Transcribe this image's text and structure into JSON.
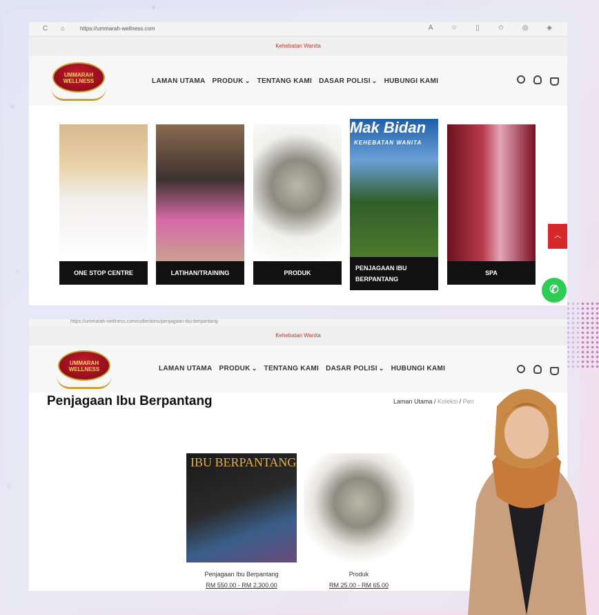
{
  "screenshot_top": {
    "url": "https://ummarah-wellness.com",
    "announcement": "Kehebatan Wanita",
    "logo_text": "UMMARAH WELLNESS",
    "nav": [
      {
        "label": "LAMAN UTAMA",
        "dropdown": false
      },
      {
        "label": "PRODUK",
        "dropdown": true
      },
      {
        "label": "TENTANG KAMI",
        "dropdown": false
      },
      {
        "label": "DASAR POLISI",
        "dropdown": true
      },
      {
        "label": "HUBUNGI KAMI",
        "dropdown": false
      }
    ],
    "tiles": [
      {
        "label": "ONE STOP CENTRE"
      },
      {
        "label": "LATIHAN/TRAINING"
      },
      {
        "label": "PRODUK"
      },
      {
        "label": "PENJAGAAN IBU BERPANTANG",
        "banner": "Mak Bidan",
        "banner_sub": "KEHEBATAN WANITA"
      },
      {
        "label": "SPA"
      }
    ]
  },
  "screenshot_bottom": {
    "url": "https://ummarah-wellness.com/collections/penjagaan-ibu-berpantang",
    "announcement": "Kehebatan Wanita",
    "logo_text": "UMMARAH WELLNESS",
    "nav": [
      {
        "label": "LAMAN UTAMA"
      },
      {
        "label": "PRODUK"
      },
      {
        "label": "TENTANG KAMI"
      },
      {
        "label": "DASAR POLISI"
      },
      {
        "label": "HUBUNGI KAMI"
      }
    ],
    "page_title": "Penjagaan Ibu Berpantang",
    "breadcrumb": {
      "home": "Laman Utama",
      "sep": "/",
      "collection": "Koleksi",
      "current": "Pen"
    },
    "products": [
      {
        "name": "Penjagaan Ibu Berpantang",
        "price": "RM 550.00 - RM 2,300.00",
        "image_text": "IBU BERPANTANG"
      },
      {
        "name": "Produk",
        "price": "RM 25.00 - RM 65.00"
      }
    ]
  },
  "colors": {
    "accent_red": "#d62a2a",
    "whatsapp_green": "#2ecc55",
    "announce_red": "#c0392b"
  },
  "icons": [
    "search-icon",
    "user-icon",
    "cart-icon",
    "whatsapp-icon",
    "chevron-up-icon"
  ]
}
